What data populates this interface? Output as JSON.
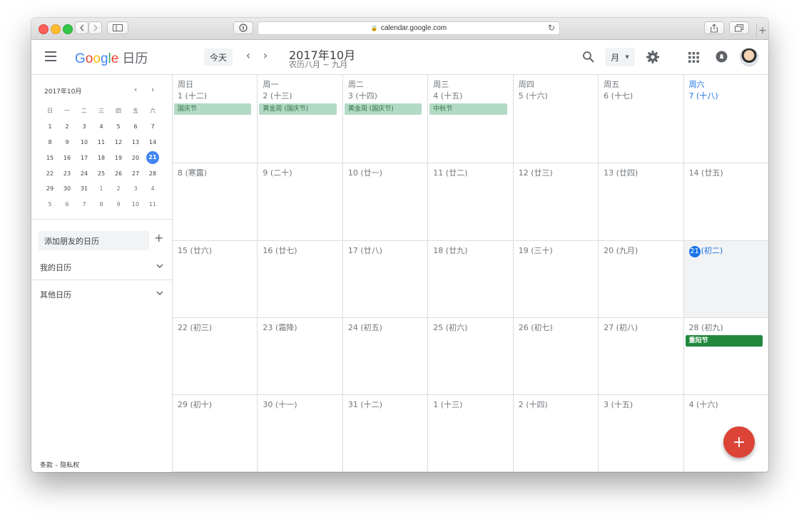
{
  "browser": {
    "url": "calendar.google.com",
    "new_tab": "+"
  },
  "header": {
    "logo_letters": [
      "G",
      "o",
      "o",
      "g",
      "l",
      "e"
    ],
    "product": "日历",
    "today_label": "今天",
    "prev": "‹",
    "next": "›",
    "title": "2017年10月",
    "subtitle": "农历八月 ~ 九月",
    "view_label": "月"
  },
  "sidebar": {
    "mini_title": "2017年10月",
    "mini_prev": "‹",
    "mini_next": "›",
    "weekday_headers": [
      "日",
      "一",
      "二",
      "三",
      "四",
      "五",
      "六"
    ],
    "mini_weeks": [
      [
        "1",
        "2",
        "3",
        "4",
        "5",
        "6",
        "7"
      ],
      [
        "8",
        "9",
        "10",
        "11",
        "12",
        "13",
        "14"
      ],
      [
        "15",
        "16",
        "17",
        "18",
        "19",
        "20",
        "21"
      ],
      [
        "22",
        "23",
        "24",
        "25",
        "26",
        "27",
        "28"
      ],
      [
        "29",
        "30",
        "31",
        "1",
        "2",
        "3",
        "4"
      ],
      [
        "5",
        "6",
        "7",
        "8",
        "9",
        "10",
        "11"
      ]
    ],
    "add_calendar": "添加朋友的日历",
    "add_plus": "+",
    "my_calendars": "我的日历",
    "other_calendars": "其他日历",
    "footer": "条款 – 隐私权"
  },
  "grid": {
    "weekdays": [
      "周日",
      "周一",
      "周二",
      "周三",
      "周四",
      "周五",
      "周六"
    ],
    "weeks": [
      [
        {
          "label": "1 (十二)",
          "events": [
            "国庆节"
          ]
        },
        {
          "label": "2 (十三)",
          "events": [
            "黄金周 (国庆节)"
          ]
        },
        {
          "label": "3 (十四)",
          "events": [
            "黄金周 (国庆节)"
          ]
        },
        {
          "label": "4 (十五)",
          "events": [
            "中秋节"
          ]
        },
        {
          "label": "5 (十六)",
          "events": []
        },
        {
          "label": "6 (十七)",
          "events": []
        },
        {
          "label": "7 (十八)",
          "events": []
        }
      ],
      [
        {
          "label": "8 (寒露)",
          "events": []
        },
        {
          "label": "9 (二十)",
          "events": []
        },
        {
          "label": "10 (廿一)",
          "events": []
        },
        {
          "label": "11 (廿二)",
          "events": []
        },
        {
          "label": "12 (廿三)",
          "events": []
        },
        {
          "label": "13 (廿四)",
          "events": []
        },
        {
          "label": "14 (廿五)",
          "events": []
        }
      ],
      [
        {
          "label": "15 (廿六)",
          "events": []
        },
        {
          "label": "16 (廿七)",
          "events": []
        },
        {
          "label": "17 (廿八)",
          "events": []
        },
        {
          "label": "18 (廿九)",
          "events": []
        },
        {
          "label": "19 (三十)",
          "events": []
        },
        {
          "label": "20 (九月)",
          "events": []
        },
        {
          "label": "(初二)",
          "today_num": "21",
          "events": []
        }
      ],
      [
        {
          "label": "22 (初三)",
          "events": []
        },
        {
          "label": "23 (霜降)",
          "events": []
        },
        {
          "label": "24 (初五)",
          "events": []
        },
        {
          "label": "25 (初六)",
          "events": []
        },
        {
          "label": "26 (初七)",
          "events": []
        },
        {
          "label": "27 (初八)",
          "events": []
        },
        {
          "label": "28 (初九)",
          "events": [
            "重阳节"
          ],
          "event_style": "solid"
        }
      ],
      [
        {
          "label": "29 (初十)",
          "events": []
        },
        {
          "label": "30 (十一)",
          "events": []
        },
        {
          "label": "31 (十二)",
          "events": []
        },
        {
          "label": "1 (十三)",
          "events": []
        },
        {
          "label": "2 (十四)",
          "events": []
        },
        {
          "label": "3 (十五)",
          "events": []
        },
        {
          "label": "4 (十六)",
          "events": []
        }
      ]
    ]
  },
  "fab_label": "+",
  "colors": {
    "accent_blue": "#1a73e8",
    "holiday_bg": "#b3dac5",
    "holiday_text": "#33754d",
    "event_green": "#21883e",
    "fab_red": "#db4437"
  }
}
